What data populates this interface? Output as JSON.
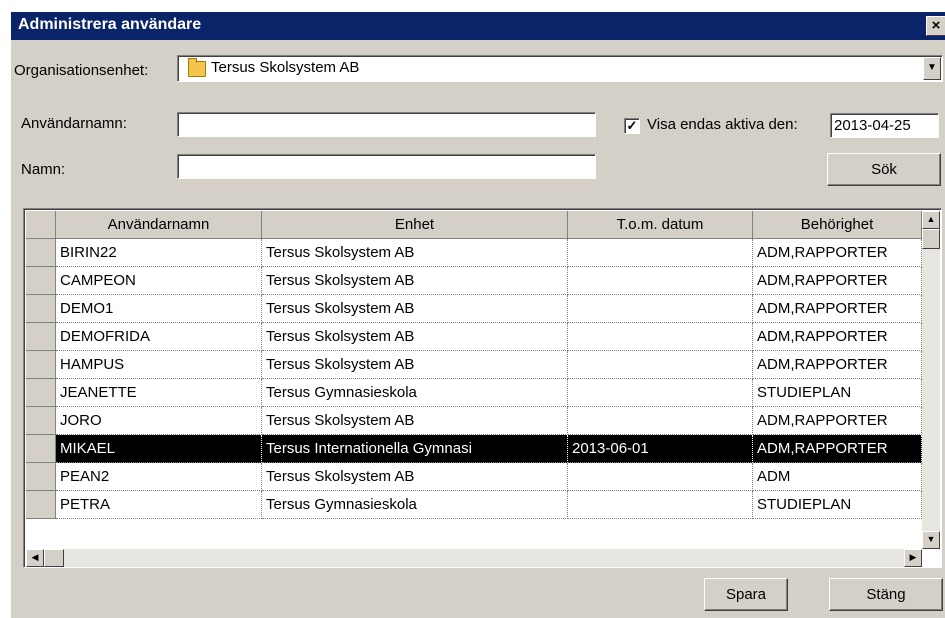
{
  "window": {
    "title": "Administrera användare",
    "close_label": "×"
  },
  "filters": {
    "org_label": "Organisationsenhet:",
    "org_value": "Tersus Skolsystem AB",
    "username_label": "Användarnamn:",
    "username_value": "",
    "name_label": "Namn:",
    "name_value": "",
    "active_checked": true,
    "active_label": "Visa endas aktiva den:",
    "active_date": "2013-04-25",
    "search_button": "Sök"
  },
  "table": {
    "columns": [
      "Användarnamn",
      "Enhet",
      "T.o.m. datum",
      "Behörighet"
    ],
    "rows": [
      {
        "user": "BIRIN22",
        "unit": "Tersus Skolsystem AB",
        "date": "",
        "role": "ADM,RAPPORTER"
      },
      {
        "user": "CAMPEON",
        "unit": "Tersus Skolsystem AB",
        "date": "",
        "role": "ADM,RAPPORTER"
      },
      {
        "user": "DEMO1",
        "unit": "Tersus Skolsystem AB",
        "date": "",
        "role": "ADM,RAPPORTER"
      },
      {
        "user": "DEMOFRIDA",
        "unit": "Tersus Skolsystem AB",
        "date": "",
        "role": "ADM,RAPPORTER"
      },
      {
        "user": "HAMPUS",
        "unit": "Tersus Skolsystem AB",
        "date": "",
        "role": "ADM,RAPPORTER"
      },
      {
        "user": "JEANETTE",
        "unit": "Tersus Gymnasieskola",
        "date": "",
        "role": "STUDIEPLAN"
      },
      {
        "user": "JORO",
        "unit": "Tersus Skolsystem AB",
        "date": "",
        "role": "ADM,RAPPORTER"
      },
      {
        "user": "MIKAEL",
        "unit": "Tersus Internationella Gymnasi",
        "date": "2013-06-01",
        "role": "ADM,RAPPORTER"
      },
      {
        "user": "PEAN2",
        "unit": "Tersus Skolsystem AB",
        "date": "",
        "role": "ADM"
      },
      {
        "user": "PETRA",
        "unit": "Tersus Gymnasieskola",
        "date": "",
        "role": "STUDIEPLAN"
      }
    ],
    "selected_index": 7
  },
  "footer": {
    "save_button": "Spara",
    "close_button": "Stäng"
  }
}
